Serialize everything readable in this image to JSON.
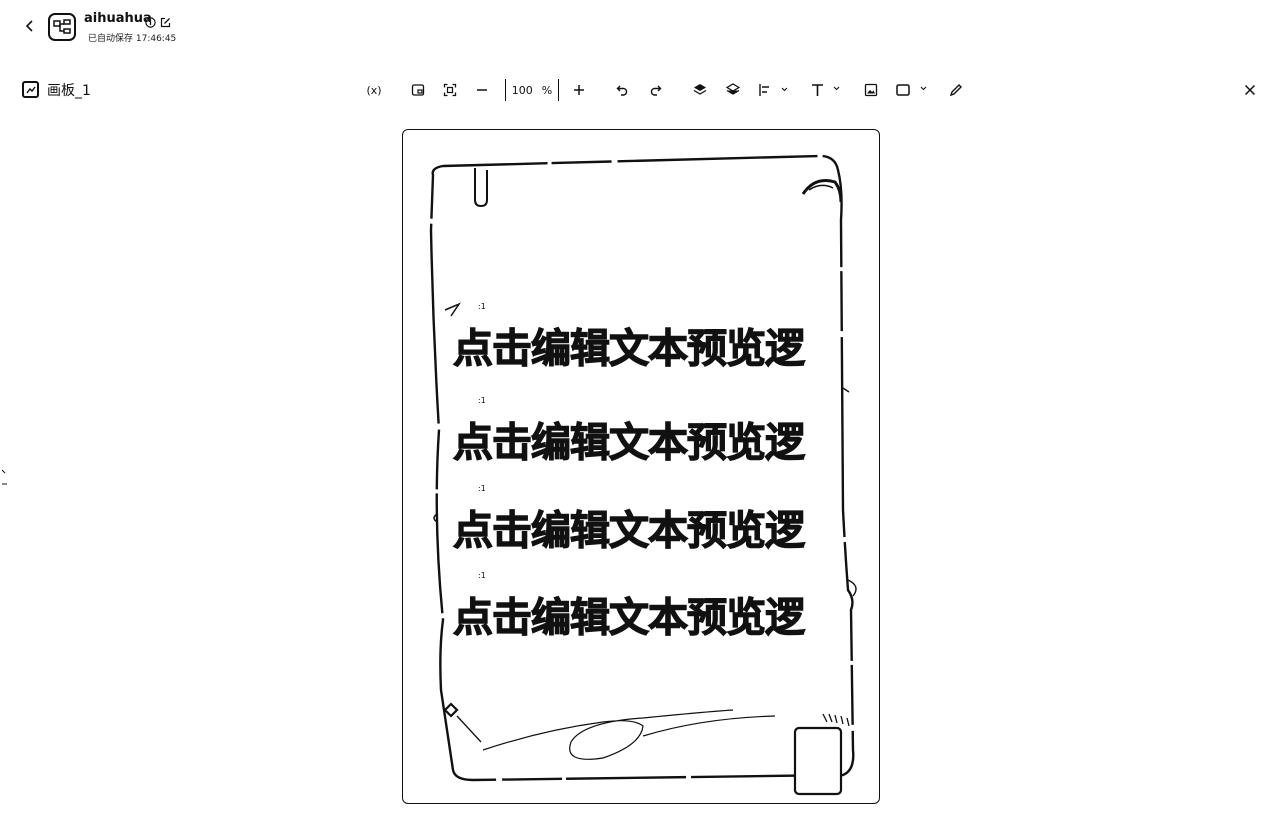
{
  "header": {
    "app_name": "aihuahua",
    "saved_status": "已自动保存 17:46:45"
  },
  "board": {
    "name": "画板_1"
  },
  "toolbar": {
    "variable_label": "(x)",
    "zoom_value": "100",
    "zoom_unit": "%"
  },
  "canvas": {
    "text_items": [
      {
        "tag": ":1",
        "text": "点击编辑文本预览逻"
      },
      {
        "tag": ":1",
        "text": "点击编辑文本预览逻"
      },
      {
        "tag": ":1",
        "text": "点击编辑文本预览逻"
      },
      {
        "tag": ":1",
        "text": "点击编辑文本预览逻"
      }
    ]
  }
}
